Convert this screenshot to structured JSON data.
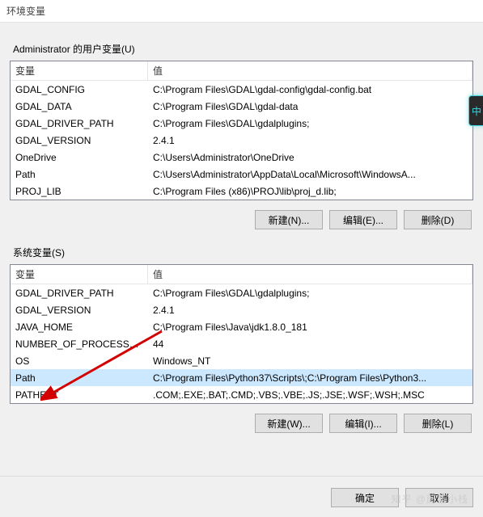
{
  "window": {
    "title": "环境变量"
  },
  "user": {
    "label": "Administrator 的用户变量(U)",
    "head": {
      "name": "变量",
      "value": "值"
    },
    "rows": [
      {
        "name": "GDAL_CONFIG",
        "value": "C:\\Program Files\\GDAL\\gdal-config\\gdal-config.bat"
      },
      {
        "name": "GDAL_DATA",
        "value": "C:\\Program Files\\GDAL\\gdal-data"
      },
      {
        "name": "GDAL_DRIVER_PATH",
        "value": "C:\\Program Files\\GDAL\\gdalplugins;"
      },
      {
        "name": "GDAL_VERSION",
        "value": "2.4.1"
      },
      {
        "name": "OneDrive",
        "value": "C:\\Users\\Administrator\\OneDrive"
      },
      {
        "name": "Path",
        "value": "C:\\Users\\Administrator\\AppData\\Local\\Microsoft\\WindowsA..."
      },
      {
        "name": "PROJ_LIB",
        "value": "C:\\Program Files (x86)\\PROJ\\lib\\proj_d.lib;"
      }
    ],
    "buttons": {
      "new": "新建(N)...",
      "edit": "编辑(E)...",
      "del": "删除(D)"
    }
  },
  "system": {
    "label": "系统变量(S)",
    "head": {
      "name": "变量",
      "value": "值"
    },
    "rows": [
      {
        "name": "GDAL_DRIVER_PATH",
        "value": "C:\\Program Files\\GDAL\\gdalplugins;"
      },
      {
        "name": "GDAL_VERSION",
        "value": "2.4.1"
      },
      {
        "name": "JAVA_HOME",
        "value": "C:\\Program Files\\Java\\jdk1.8.0_181"
      },
      {
        "name": "NUMBER_OF_PROCESSORS",
        "value": "44"
      },
      {
        "name": "OS",
        "value": "Windows_NT"
      },
      {
        "name": "Path",
        "value": "C:\\Program Files\\Python37\\Scripts\\;C:\\Program Files\\Python3..."
      },
      {
        "name": "PATHEXT",
        "value": ".COM;.EXE;.BAT;.CMD;.VBS;.VBE;.JS;.JSE;.WSF;.WSH;.MSC"
      }
    ],
    "selected_index": 5,
    "buttons": {
      "new": "新建(W)...",
      "edit": "编辑(I)...",
      "del": "删除(L)"
    }
  },
  "footer": {
    "ok": "确定",
    "cancel": "取消"
  },
  "side_tab": "中",
  "watermark": "知乎 @蔚蓝小栈"
}
